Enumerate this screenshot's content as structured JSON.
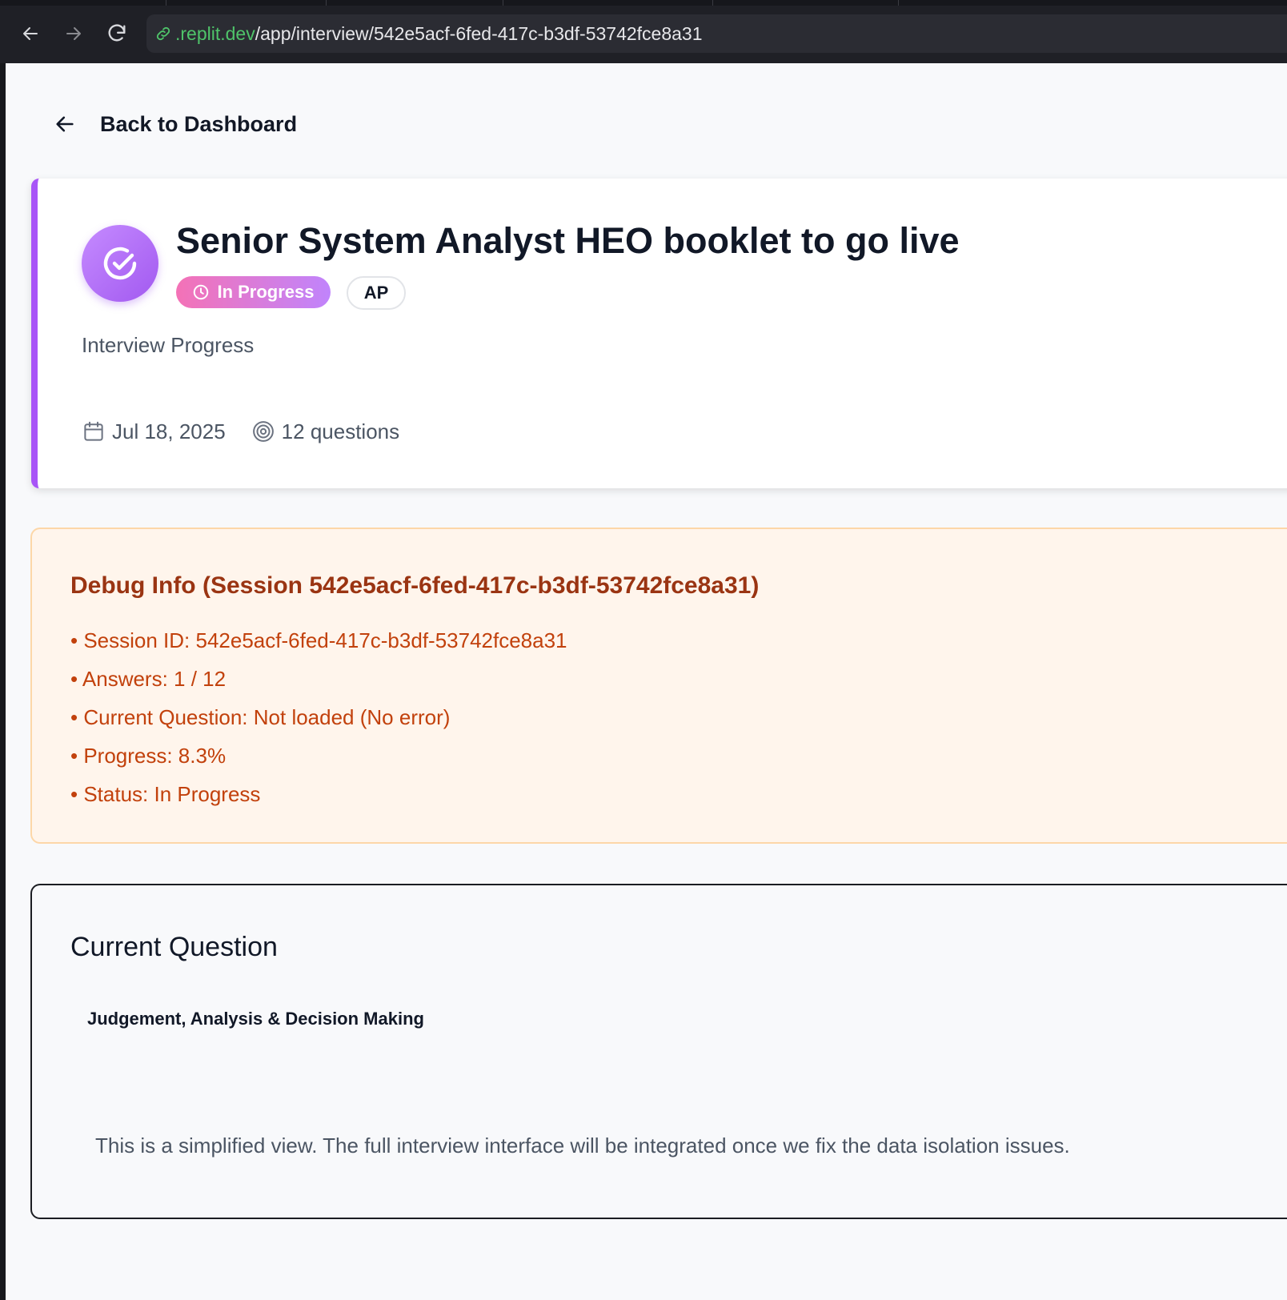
{
  "browser": {
    "address_host": ".replit.dev",
    "address_path": "/app/interview/542e5acf-6fed-417c-b3df-53742fce8a31"
  },
  "nav": {
    "back_label": "Back to Dashboard"
  },
  "interview": {
    "title": "Senior System Analyst HEO booklet to go live",
    "status": "In Progress",
    "initials": "AP",
    "progress_label": "Interview Progress",
    "date": "Jul 18, 2025",
    "question_count": "12 questions",
    "accent_color": "#a855f7"
  },
  "debug": {
    "title": "Debug Info (Session 542e5acf-6fed-417c-b3df-53742fce8a31)",
    "items": [
      "• Session ID: 542e5acf-6fed-417c-b3df-53742fce8a31",
      "• Answers: 1 / 12",
      "• Current Question: Not loaded (No error)",
      "• Progress: 8.3%",
      "• Status: In Progress"
    ]
  },
  "question": {
    "heading": "Current Question",
    "category": "Judgement, Analysis & Decision Making",
    "note": "This is a simplified view. The full interview interface will be integrated once we fix the data isolation issues."
  }
}
